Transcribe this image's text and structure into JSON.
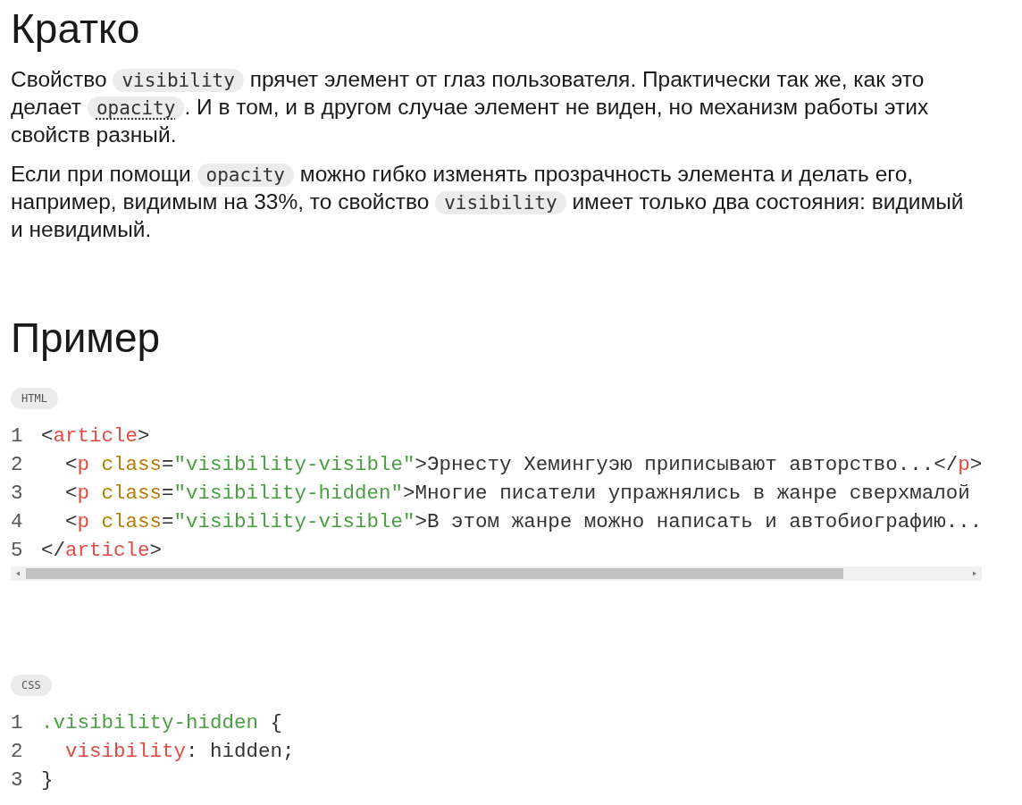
{
  "sections": [
    {
      "heading": "Кратко",
      "paragraphs": [
        [
          {
            "kind": "text",
            "text": "Свойство "
          },
          {
            "kind": "code",
            "text": "visibility"
          },
          {
            "kind": "text",
            "text": " прячет элемент от глаз пользователя. Практически так же, как это делает "
          },
          {
            "kind": "link",
            "text": "opacity"
          },
          {
            "kind": "text",
            "text": ". И в том, и в другом случае элемент не виден, но механизм работы этих свойств разный."
          }
        ],
        [
          {
            "kind": "text",
            "text": "Если при помощи "
          },
          {
            "kind": "code",
            "text": "opacity"
          },
          {
            "kind": "text",
            "text": " можно гибко изменять прозрачность элемента и делать его, например, видимым на 33%, то свойство "
          },
          {
            "kind": "code",
            "text": "visibility"
          },
          {
            "kind": "text",
            "text": " имеет только два состояния: видимый и невидимый."
          }
        ]
      ]
    },
    {
      "heading": "Пример",
      "examples": [
        {
          "language": "HTML",
          "scrollbar": true,
          "lines": [
            {
              "number": "1",
              "tokens": [
                {
                  "kind": "punct",
                  "text": "<"
                },
                {
                  "kind": "tag",
                  "text": "article"
                },
                {
                  "kind": "punct",
                  "text": ">"
                }
              ]
            },
            {
              "number": "2",
              "tokens": [
                {
                  "kind": "punct",
                  "text": "  <"
                },
                {
                  "kind": "tag",
                  "text": "p"
                },
                {
                  "kind": "attr",
                  "text": " class"
                },
                {
                  "kind": "punct",
                  "text": "="
                },
                {
                  "kind": "string",
                  "text": "\"visibility-visible\""
                },
                {
                  "kind": "punct",
                  "text": ">Эрнесту Хемингуэю приписывают авторство...</"
                },
                {
                  "kind": "tag",
                  "text": "p"
                },
                {
                  "kind": "punct",
                  "text": ">"
                }
              ]
            },
            {
              "number": "3",
              "tokens": [
                {
                  "kind": "punct",
                  "text": "  <"
                },
                {
                  "kind": "tag",
                  "text": "p"
                },
                {
                  "kind": "attr",
                  "text": " class"
                },
                {
                  "kind": "punct",
                  "text": "="
                },
                {
                  "kind": "string",
                  "text": "\"visibility-hidden\""
                },
                {
                  "kind": "punct",
                  "text": ">Многие писатели упражнялись в жанре сверхмалой"
                }
              ]
            },
            {
              "number": "4",
              "tokens": [
                {
                  "kind": "punct",
                  "text": "  <"
                },
                {
                  "kind": "tag",
                  "text": "p"
                },
                {
                  "kind": "attr",
                  "text": " class"
                },
                {
                  "kind": "punct",
                  "text": "="
                },
                {
                  "kind": "string",
                  "text": "\"visibility-visible\""
                },
                {
                  "kind": "punct",
                  "text": ">В этом жанре можно написать и автобиографию..."
                }
              ]
            },
            {
              "number": "5",
              "tokens": [
                {
                  "kind": "punct",
                  "text": "</"
                },
                {
                  "kind": "tag",
                  "text": "article"
                },
                {
                  "kind": "punct",
                  "text": ">"
                }
              ]
            }
          ]
        },
        {
          "language": "CSS",
          "scrollbar": false,
          "lines": [
            {
              "number": "1",
              "tokens": [
                {
                  "kind": "string",
                  "text": ".visibility-hidden"
                },
                {
                  "kind": "punct",
                  "text": " {"
                }
              ]
            },
            {
              "number": "2",
              "tokens": [
                {
                  "kind": "tag",
                  "text": "  visibility"
                },
                {
                  "kind": "punct",
                  "text": ": hidden;"
                }
              ]
            },
            {
              "number": "3",
              "tokens": [
                {
                  "kind": "punct",
                  "text": "}"
                }
              ]
            }
          ]
        }
      ]
    }
  ]
}
